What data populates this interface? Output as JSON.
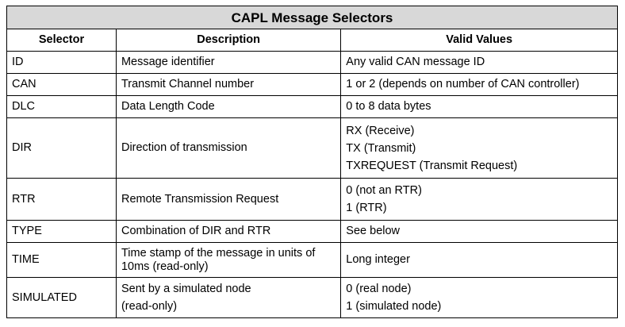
{
  "table": {
    "title": "CAPL Message Selectors",
    "headers": [
      "Selector",
      "Description",
      "Valid Values"
    ],
    "rows": [
      {
        "selector": "ID",
        "description": [
          "Message identifier"
        ],
        "values": [
          "Any valid CAN message ID"
        ]
      },
      {
        "selector": "CAN",
        "description": [
          "Transmit Channel number"
        ],
        "values": [
          "1 or 2 (depends on number of CAN controller)"
        ]
      },
      {
        "selector": "DLC",
        "description": [
          "Data Length Code"
        ],
        "values": [
          "0 to 8 data bytes"
        ]
      },
      {
        "selector": "DIR",
        "description": [
          "Direction of transmission"
        ],
        "values": [
          "RX (Receive)",
          "TX (Transmit)",
          "TXREQUEST (Transmit Request)"
        ]
      },
      {
        "selector": "RTR",
        "description": [
          "Remote Transmission Request"
        ],
        "values": [
          "0 (not an RTR)",
          "1 (RTR)"
        ]
      },
      {
        "selector": "TYPE",
        "description": [
          "Combination of DIR and RTR"
        ],
        "values": [
          "See below"
        ]
      },
      {
        "selector": "TIME",
        "description": [
          "Time stamp of the message in units of",
          "10ms (read-only)"
        ],
        "values": [
          "Long integer"
        ]
      },
      {
        "selector": "SIMULATED",
        "description": [
          "Sent by a simulated node",
          "(read-only)"
        ],
        "values": [
          "0 (real node)",
          "1 (simulated node)"
        ]
      }
    ]
  }
}
